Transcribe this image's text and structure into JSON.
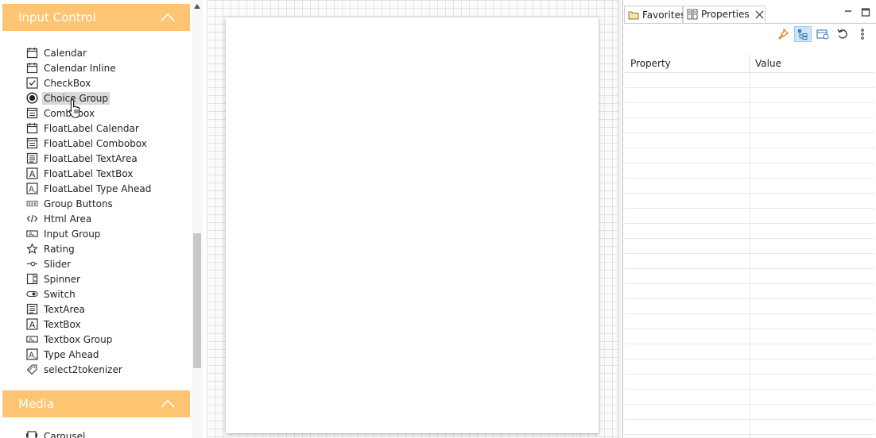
{
  "palette": {
    "section_input": {
      "title": "Input Control",
      "toggle_icon": "chevron-up-icon"
    },
    "section_media": {
      "title": "Media",
      "toggle_icon": "chevron-up-icon"
    },
    "items": [
      {
        "label": "Calendar",
        "icon": "calendar-icon"
      },
      {
        "label": "Calendar Inline",
        "icon": "calendar-icon"
      },
      {
        "label": "CheckBox",
        "icon": "checkbox-icon"
      },
      {
        "label": "Choice Group",
        "icon": "radio-icon",
        "selected": true
      },
      {
        "label": "Combobox",
        "icon": "combobox-icon"
      },
      {
        "label": "FloatLabel Calendar",
        "icon": "calendar-icon"
      },
      {
        "label": "FloatLabel Combobox",
        "icon": "combobox-icon"
      },
      {
        "label": "FloatLabel TextArea",
        "icon": "textarea-icon"
      },
      {
        "label": "FloatLabel TextBox",
        "icon": "textbox-icon"
      },
      {
        "label": "FloatLabel Type Ahead",
        "icon": "typeahead-icon"
      },
      {
        "label": "Group Buttons",
        "icon": "group-buttons-icon"
      },
      {
        "label": "Html Area",
        "icon": "code-icon"
      },
      {
        "label": "Input Group",
        "icon": "input-group-icon"
      },
      {
        "label": "Rating",
        "icon": "star-icon"
      },
      {
        "label": "Slider",
        "icon": "slider-icon"
      },
      {
        "label": "Spinner",
        "icon": "spinner-icon"
      },
      {
        "label": "Switch",
        "icon": "switch-icon"
      },
      {
        "label": "TextArea",
        "icon": "textarea-icon"
      },
      {
        "label": "TextBox",
        "icon": "textbox-icon"
      },
      {
        "label": "Textbox Group",
        "icon": "input-group-icon"
      },
      {
        "label": "Type Ahead",
        "icon": "typeahead-icon"
      },
      {
        "label": "select2tokenizer",
        "icon": "tag-icon"
      }
    ],
    "media_items": [
      {
        "label": "Carousel",
        "icon": "carousel-icon"
      }
    ]
  },
  "properties_view": {
    "tabs": [
      {
        "label": "Favorites",
        "icon": "folder-icon",
        "active": false
      },
      {
        "label": "Properties",
        "icon": "properties-icon",
        "active": true
      }
    ],
    "toolbar": [
      {
        "name": "pin-icon",
        "active": false
      },
      {
        "name": "categories-icon",
        "active": true
      },
      {
        "name": "advanced-icon",
        "active": false
      },
      {
        "name": "restore-default-icon",
        "active": false
      },
      {
        "name": "view-menu-icon",
        "active": false
      }
    ],
    "columns": {
      "property": "Property",
      "value": "Value"
    }
  },
  "colors": {
    "section_header_bg": "#fdc472",
    "section_header_text": "#ffffff",
    "selected_item_bg": "#d9d9d9",
    "active_tool_bg": "#cde6f7"
  }
}
